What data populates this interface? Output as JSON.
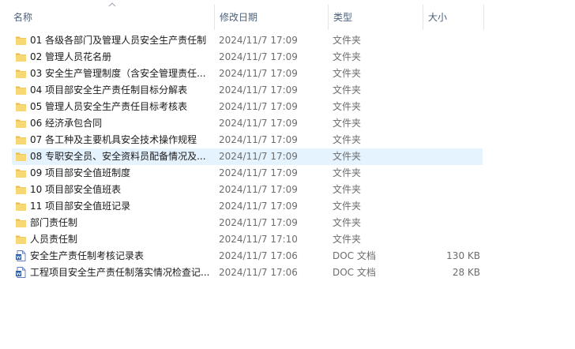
{
  "columns": {
    "name": "名称",
    "date": "修改日期",
    "type": "类型",
    "size": "大小"
  },
  "files": [
    {
      "name": "01 各级各部门及管理人员安全生产责任制",
      "date": "2024/11/7 17:09",
      "type": "文件夹",
      "size": "",
      "icon": "folder-icon"
    },
    {
      "name": "02 管理人员花名册",
      "date": "2024/11/7 17:09",
      "type": "文件夹",
      "size": "",
      "icon": "folder-icon"
    },
    {
      "name": "03 安全生产管理制度（含安全管理责任...",
      "date": "2024/11/7 17:09",
      "type": "文件夹",
      "size": "",
      "icon": "folder-icon"
    },
    {
      "name": "04 项目部安全生产责任制目标分解表",
      "date": "2024/11/7 17:09",
      "type": "文件夹",
      "size": "",
      "icon": "folder-icon"
    },
    {
      "name": "05 管理人员安全生产责任目标考核表",
      "date": "2024/11/7 17:09",
      "type": "文件夹",
      "size": "",
      "icon": "folder-icon"
    },
    {
      "name": "06 经济承包合同",
      "date": "2024/11/7 17:09",
      "type": "文件夹",
      "size": "",
      "icon": "folder-icon"
    },
    {
      "name": "07 各工种及主要机具安全技术操作规程",
      "date": "2024/11/7 17:09",
      "type": "文件夹",
      "size": "",
      "icon": "folder-icon"
    },
    {
      "name": "08 专职安全员、安全资料员配备情况及...",
      "date": "2024/11/7 17:09",
      "type": "文件夹",
      "size": "",
      "icon": "folder-icon"
    },
    {
      "name": "09 项目部安全值班制度",
      "date": "2024/11/7 17:09",
      "type": "文件夹",
      "size": "",
      "icon": "folder-icon"
    },
    {
      "name": "10 项目部安全值班表",
      "date": "2024/11/7 17:09",
      "type": "文件夹",
      "size": "",
      "icon": "folder-icon"
    },
    {
      "name": "11 项目部安全值班记录",
      "date": "2024/11/7 17:09",
      "type": "文件夹",
      "size": "",
      "icon": "folder-icon"
    },
    {
      "name": "部门责任制",
      "date": "2024/11/7 17:09",
      "type": "文件夹",
      "size": "",
      "icon": "folder-icon"
    },
    {
      "name": "人员责任制",
      "date": "2024/11/7 17:10",
      "type": "文件夹",
      "size": "",
      "icon": "folder-icon"
    },
    {
      "name": "安全生产责任制考核记录表",
      "date": "2024/11/7 17:06",
      "type": "DOC 文档",
      "size": "130 KB",
      "icon": "word-doc-icon"
    },
    {
      "name": "工程项目安全生产责任制落实情况检查记...",
      "date": "2024/11/7 17:06",
      "type": "DOC 文档",
      "size": "28 KB",
      "icon": "word-doc-icon"
    }
  ],
  "hover_index": 7,
  "colors": {
    "folder": "#f8d775",
    "folder_dark": "#e9b949",
    "doc_blue": "#2b579a",
    "hover": "#e5f3ff",
    "header_text": "#4c607a"
  }
}
